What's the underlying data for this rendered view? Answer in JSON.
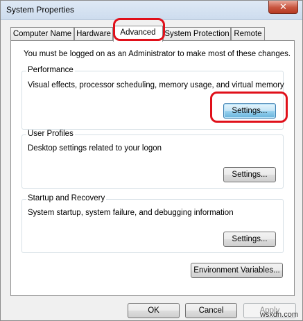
{
  "window": {
    "title": "System Properties",
    "close_glyph": "✕",
    "close_icon": "close-icon"
  },
  "tabs": [
    {
      "label": "Computer Name",
      "active": false
    },
    {
      "label": "Hardware",
      "active": false
    },
    {
      "label": "Advanced",
      "active": true
    },
    {
      "label": "System Protection",
      "active": false
    },
    {
      "label": "Remote",
      "active": false
    }
  ],
  "admin_notice": "You must be logged on as an Administrator to make most of these changes.",
  "performance": {
    "title": "Performance",
    "description": "Visual effects, processor scheduling, memory usage, and virtual memory",
    "button": "Settings..."
  },
  "user_profiles": {
    "title": "User Profiles",
    "description": "Desktop settings related to your logon",
    "button": "Settings..."
  },
  "startup_recovery": {
    "title": "Startup and Recovery",
    "description": "System startup, system failure, and debugging information",
    "button": "Settings..."
  },
  "environment_button": "Environment Variables...",
  "dialog_buttons": {
    "ok": "OK",
    "cancel": "Cancel",
    "apply": "Apply"
  },
  "watermark": "wsxdn.com",
  "colors": {
    "highlight_ring": "#e0101a",
    "panel": "#ffffff",
    "window": "#f0f0f0"
  }
}
